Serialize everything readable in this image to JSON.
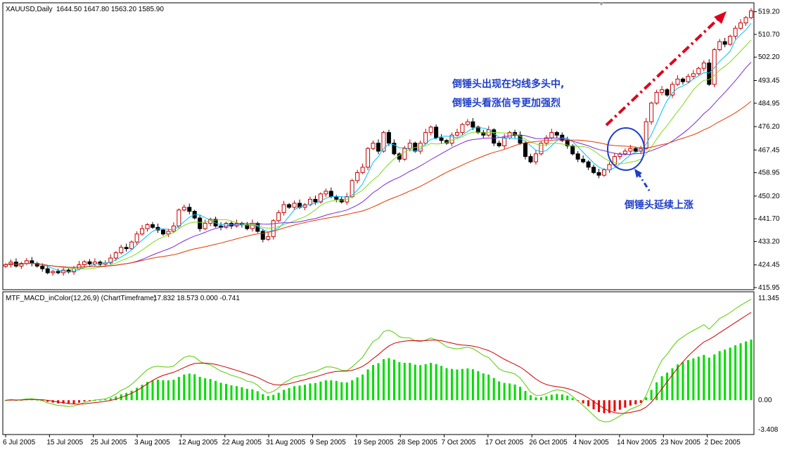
{
  "chart_data": [
    {
      "type": "candlestick",
      "header": {
        "symbol": "XAUUSD,Daily",
        "ohlc": "1644.50 1647.80 1563.20 1585.90"
      },
      "ylim": [
        415.95,
        522.0
      ],
      "yticks": [
        "519.20",
        "510.70",
        "502.20",
        "493.45",
        "484.95",
        "476.20",
        "467.45",
        "458.95",
        "450.20",
        "441.70",
        "433.20",
        "424.45",
        "415.95"
      ],
      "xticks": [
        "6 Jul 2005",
        "15 Jul 2005",
        "25 Jul 2005",
        "3 Aug 2005",
        "12 Aug 2005",
        "22 Aug 2005",
        "31 Aug 2005",
        "9 Sep 2005",
        "19 Sep 2005",
        "28 Sep 2005",
        "7 Oct 2005",
        "17 Oct 2005",
        "26 Oct 2005",
        "4 Nov 2005",
        "14 Nov 2005",
        "23 Nov 2005",
        "2 Dec 2005"
      ],
      "close": [
        424.5,
        425.5,
        424,
        425,
        426,
        425,
        424,
        423,
        421.5,
        422,
        421.5,
        422.5,
        421.8,
        423,
        424.5,
        425.6,
        424.8,
        425.5,
        424.7,
        425.2,
        427,
        429,
        431,
        430.5,
        433,
        436,
        438,
        439.5,
        438.5,
        437.5,
        436,
        437,
        439,
        445,
        446,
        444.5,
        442,
        438,
        440,
        441.5,
        439,
        438.5,
        440,
        439,
        440,
        439.5,
        438,
        440,
        437,
        434,
        435,
        441,
        444,
        447,
        446,
        447.5,
        446,
        447,
        449,
        448,
        451,
        452,
        450,
        449,
        448,
        450,
        456,
        459,
        461,
        468,
        470,
        467,
        474,
        470,
        466,
        464,
        468,
        470,
        467,
        470,
        474,
        476,
        472,
        471,
        470,
        473,
        474,
        477,
        478,
        476,
        474,
        473,
        475,
        470,
        469,
        472,
        474,
        473,
        470,
        465,
        463,
        466,
        470,
        472,
        474,
        473,
        471,
        469,
        466,
        464,
        463,
        461,
        459,
        458,
        460,
        462,
        465,
        466,
        467,
        468,
        467,
        468,
        478,
        485,
        489,
        490,
        488,
        492,
        494,
        493,
        495,
        496,
        498,
        500,
        492,
        505,
        508,
        507,
        510,
        513,
        515,
        517,
        519.5
      ],
      "annotations": [
        {
          "line1": "倒锤头出现在均线多头中,",
          "line2": "倒锤头看涨信号更加强烈"
        },
        {
          "text": "倒锤头延续上涨"
        }
      ],
      "colors": {
        "up": "#c40000",
        "down": "#000000",
        "ma1": "#00bfff",
        "ma2": "#7ddc1f",
        "ma3": "#7a2bd6",
        "ma4": "#e03a00",
        "ann": "#1f3ec9",
        "arrow": "#e0001b"
      }
    },
    {
      "type": "bar+line",
      "header": {
        "title": "MTF_MACD_inColor(12,26,9) (ChartTimeframe)",
        "values": "17.832 18.573 0.000 -0.741"
      },
      "ylim": [
        -3.408,
        11.345
      ],
      "yticks": [
        "11.345",
        "0.00",
        "-3.408"
      ],
      "colors": {
        "hist_pos": "#00dd00",
        "hist_neg": "#ee0000",
        "macd": "#55cc00",
        "signal": "#cc0000"
      }
    }
  ]
}
